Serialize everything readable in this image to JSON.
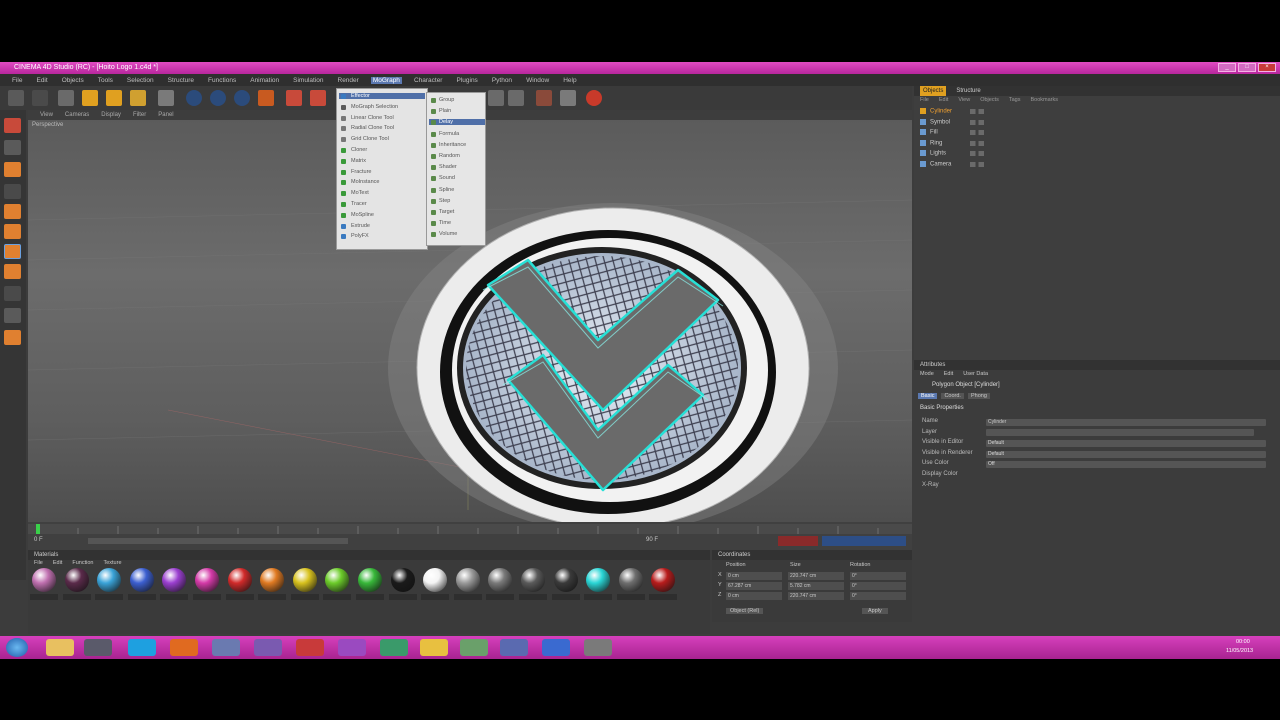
{
  "window": {
    "title": "CINEMA 4D Studio (RC) - [Hoito Logo 1.c4d *]"
  },
  "menubar": {
    "items": [
      "File",
      "Edit",
      "Objects",
      "Tools",
      "Selection",
      "Structure",
      "Functions",
      "Animation",
      "Simulation",
      "Render",
      "MoGraph",
      "Character",
      "Plugins",
      "Python",
      "Window",
      "Help"
    ],
    "active_index": 10
  },
  "mograph_menu": {
    "items": [
      "Effector",
      "MoGraph Selection",
      "Linear Clone Tool",
      "Radial Clone Tool",
      "Grid Clone Tool",
      "Cloner",
      "Matrix",
      "Fracture",
      "MoInstance",
      "MoText",
      "Tracer",
      "MoSpline",
      "Extrude",
      "PolyFX"
    ],
    "highlight_index": 0
  },
  "effector_submenu": {
    "items": [
      "Group",
      "Plain",
      "Delay",
      "Formula",
      "Inheritance",
      "Random",
      "Shader",
      "Sound",
      "Spline",
      "Step",
      "Target",
      "Time",
      "Volume"
    ],
    "highlight_index": 2
  },
  "viewport": {
    "menu": [
      "View",
      "Cameras",
      "Display",
      "Filter",
      "Panel"
    ],
    "label": "Perspective"
  },
  "object_manager": {
    "tabs": [
      "Objects",
      "Structure"
    ],
    "menu": [
      "File",
      "Edit",
      "View",
      "Objects",
      "Tags",
      "Bookmarks"
    ],
    "rows": [
      "Cylinder",
      "Symbol",
      "Fill",
      "Ring",
      "Lights",
      "Camera"
    ]
  },
  "attributes": {
    "title": "Attributes",
    "menu": [
      "Mode",
      "Edit",
      "User Data"
    ],
    "object_label": "Polygon Object [Cylinder]",
    "tabs": [
      "Basic",
      "Coord.",
      "Phong"
    ],
    "section": "Basic Properties",
    "fields": [
      "Name",
      "Layer",
      "Visible in Editor",
      "Visible in Renderer",
      "Use Color",
      "Display Color",
      "X-Ray"
    ],
    "name_value": "Cylinder",
    "visible_editor_value": "Default",
    "visible_renderer_value": "Default",
    "use_color_value": "Off"
  },
  "materials": {
    "title": "Materials",
    "menu": [
      "File",
      "Edit",
      "Function",
      "Texture"
    ],
    "colors": [
      "#c070b0",
      "#5a2a4a",
      "#3aa3d8",
      "#3c5fd0",
      "#9b3fd0",
      "#d43aa8",
      "#d12a2a",
      "#e07a22",
      "#d8c21e",
      "#6ccc2a",
      "#38b83a",
      "#1a1a1a",
      "#f4f4f4",
      "#9a9a9a",
      "#7a7a7a",
      "#5a5a5a",
      "#3a3a3a",
      "#2ad6d6",
      "#6e6e6e",
      "#b81c1c"
    ]
  },
  "coordinates": {
    "title": "Coordinates",
    "headers": [
      "Position",
      "Size",
      "Rotation"
    ],
    "rows": [
      {
        "axis": "X",
        "pos": "0 cm",
        "size": "220.747 cm",
        "rot": "0°"
      },
      {
        "axis": "Y",
        "pos": "67.287 cm",
        "size": "5.782 cm",
        "rot": "0°"
      },
      {
        "axis": "Z",
        "pos": "0 cm",
        "size": "220.747 cm",
        "rot": "0°"
      }
    ],
    "mode": "Object (Rel)",
    "apply": "Apply"
  },
  "timeline": {
    "start_frame": "0 F",
    "end_frame": "90 F",
    "current": "0 F"
  },
  "taskbar": {
    "time": "00:00",
    "date": "11/05/2013"
  },
  "icons": {
    "start": "windows-start-icon",
    "explorer": "folder-icon",
    "skype": "skype-icon",
    "firefox": "firefox-icon"
  }
}
